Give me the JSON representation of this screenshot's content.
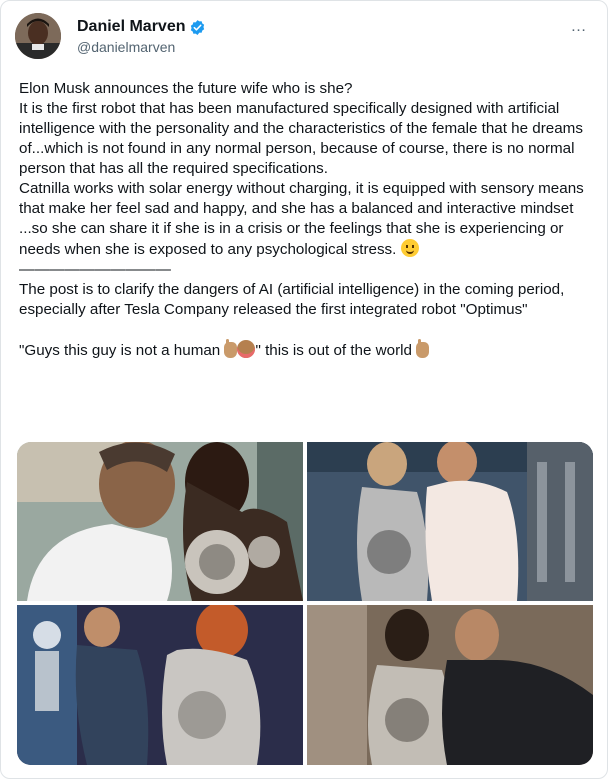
{
  "author": {
    "display_name": "Daniel Marven",
    "handle": "@danielmarven",
    "verified": true,
    "avatar_icon": "profile-photo"
  },
  "more_icon": "…",
  "tweet": {
    "p1": "Elon Musk announces the future wife who is she?",
    "p2": "It is the first robot that has been manufactured specifically designed with artificial intelligence with the personality and the characteristics of the female that he dreams of...which is not found in any normal person, because of course, there is no normal person that has all the required specifications.",
    "p3": "Catnilla works with solar energy without charging, it is equipped with sensory means that make her feel sad and happy, and she has a balanced and interactive mindset ...so she can share it if she is in a crisis or the feelings that she is experiencing or needs when she is exposed to any psychological stress.",
    "divider": "——————————",
    "p4": "The post is to clarify the dangers of AI (artificial intelligence) in the coming period, especially after Tesla Company released the first integrated robot \"Optimus\"",
    "quote_a": "\"Guys this guy is not a human ",
    "quote_b": "\" this is out of the world "
  },
  "media": {
    "count": 4,
    "images": [
      {
        "name": "photo-man-kissing-robot"
      },
      {
        "name": "photo-robot-woman-embrace"
      },
      {
        "name": "photo-man-dancing-with-redhead-robot"
      },
      {
        "name": "photo-robot-kissing-man"
      }
    ]
  },
  "colors": {
    "text": "#0f1419",
    "secondary": "#536471",
    "verified_badge": "#1d9bf0",
    "border": "#dfe3e6"
  }
}
